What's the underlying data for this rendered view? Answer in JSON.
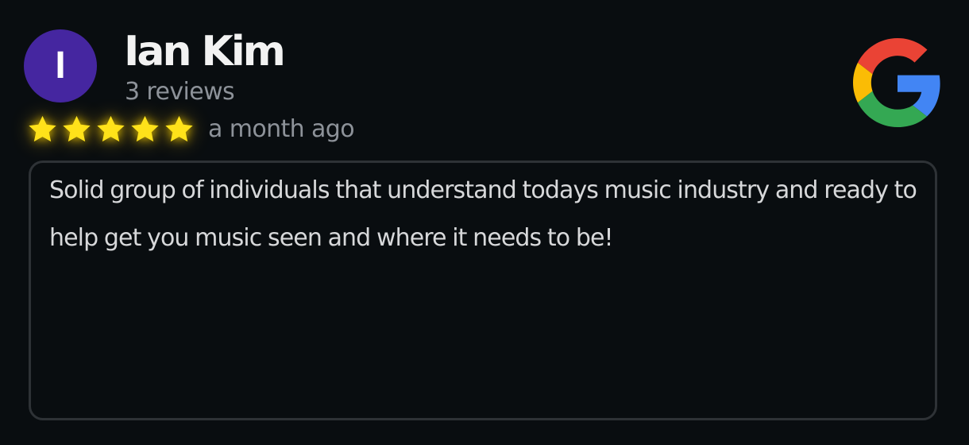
{
  "reviewer": {
    "initial": "I",
    "name": "Ian Kim",
    "reviews_count": "3 reviews",
    "avatar_color": "#4526a0"
  },
  "rating": {
    "stars": 5,
    "max_stars": 5,
    "star_color": "#ffe21a",
    "time_ago": "a month ago"
  },
  "source": {
    "icon": "google-g-icon"
  },
  "review": {
    "text": "Solid group of individuals that understand todays music industry and ready to help get you music seen and where it needs to be!"
  }
}
